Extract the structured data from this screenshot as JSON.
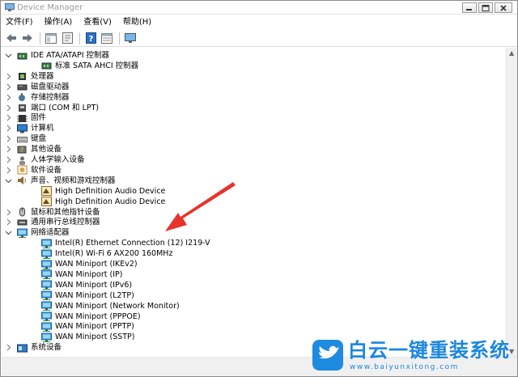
{
  "window": {
    "title": "Device Manager"
  },
  "menu": [
    "文件(F)",
    "操作(A)",
    "查看(V)",
    "帮助(H)"
  ],
  "toolbar": [
    "back-icon",
    "forward-icon",
    "show-hide-icon",
    "properties-icon",
    "help-icon",
    "view-icon",
    "monitor-icon"
  ],
  "tree": {
    "rows": [
      {
        "label": "IDE ATA/ATAPI 控制器",
        "level": 0,
        "state": "expanded",
        "icon": "ide-controller-icon"
      },
      {
        "label": "标准 SATA AHCI 控制器",
        "level": 1,
        "state": "leaf",
        "icon": "ide-controller-icon"
      },
      {
        "label": "处理器",
        "level": 0,
        "state": "collapsed",
        "icon": "processor-icon"
      },
      {
        "label": "磁盘驱动器",
        "level": 0,
        "state": "collapsed",
        "icon": "disk-drive-icon"
      },
      {
        "label": "存储控制器",
        "level": 0,
        "state": "collapsed",
        "icon": "storage-controller-icon"
      },
      {
        "label": "端口 (COM 和 LPT)",
        "level": 0,
        "state": "collapsed",
        "icon": "port-icon"
      },
      {
        "label": "固件",
        "level": 0,
        "state": "collapsed",
        "icon": "firmware-icon"
      },
      {
        "label": "计算机",
        "level": 0,
        "state": "collapsed",
        "icon": "computer-icon"
      },
      {
        "label": "键盘",
        "level": 0,
        "state": "collapsed",
        "icon": "keyboard-icon"
      },
      {
        "label": "其他设备",
        "level": 0,
        "state": "collapsed",
        "icon": "other-devices-icon"
      },
      {
        "label": "人体学输入设备",
        "level": 0,
        "state": "collapsed",
        "icon": "hid-icon"
      },
      {
        "label": "软件设备",
        "level": 0,
        "state": "collapsed",
        "icon": "software-device-icon"
      },
      {
        "label": "声音、视频和游戏控制器",
        "level": 0,
        "state": "expanded",
        "icon": "sound-icon"
      },
      {
        "label": "High Definition Audio Device",
        "level": 1,
        "state": "leaf",
        "icon": "audio-device-icon"
      },
      {
        "label": "High Definition Audio Device",
        "level": 1,
        "state": "leaf",
        "icon": "audio-device-icon"
      },
      {
        "label": "鼠标和其他指针设备",
        "level": 0,
        "state": "collapsed",
        "icon": "mouse-icon"
      },
      {
        "label": "通用串行总线控制器",
        "level": 0,
        "state": "collapsed",
        "icon": "usb-icon"
      },
      {
        "label": "网络适配器",
        "level": 0,
        "state": "expanded",
        "icon": "network-adapter-icon"
      },
      {
        "label": "Intel(R) Ethernet Connection (12) I219-V",
        "level": 1,
        "state": "leaf",
        "icon": "network-adapter-icon"
      },
      {
        "label": "Intel(R) Wi-Fi 6 AX200 160MHz",
        "level": 1,
        "state": "leaf",
        "icon": "network-adapter-icon"
      },
      {
        "label": "WAN Miniport (IKEv2)",
        "level": 1,
        "state": "leaf",
        "icon": "network-adapter-icon"
      },
      {
        "label": "WAN Miniport (IP)",
        "level": 1,
        "state": "leaf",
        "icon": "network-adapter-icon"
      },
      {
        "label": "WAN Miniport (IPv6)",
        "level": 1,
        "state": "leaf",
        "icon": "network-adapter-icon"
      },
      {
        "label": "WAN Miniport (L2TP)",
        "level": 1,
        "state": "leaf",
        "icon": "network-adapter-icon"
      },
      {
        "label": "WAN Miniport (Network Monitor)",
        "level": 1,
        "state": "leaf",
        "icon": "network-adapter-icon"
      },
      {
        "label": "WAN Miniport (PPPOE)",
        "level": 1,
        "state": "leaf",
        "icon": "network-adapter-icon"
      },
      {
        "label": "WAN Miniport (PPTP)",
        "level": 1,
        "state": "leaf",
        "icon": "network-adapter-icon"
      },
      {
        "label": "WAN Miniport (SSTP)",
        "level": 1,
        "state": "leaf",
        "icon": "network-adapter-icon"
      },
      {
        "label": "系统设备",
        "level": 0,
        "state": "collapsed",
        "icon": "system-devices-icon"
      }
    ]
  },
  "watermark": {
    "brand": "白云一键重装系统",
    "url": "www.baiyunxitong.com"
  },
  "colors": {
    "accent": "#1c86de",
    "arrow": "#e8322d",
    "network": "#2a8fd8"
  }
}
